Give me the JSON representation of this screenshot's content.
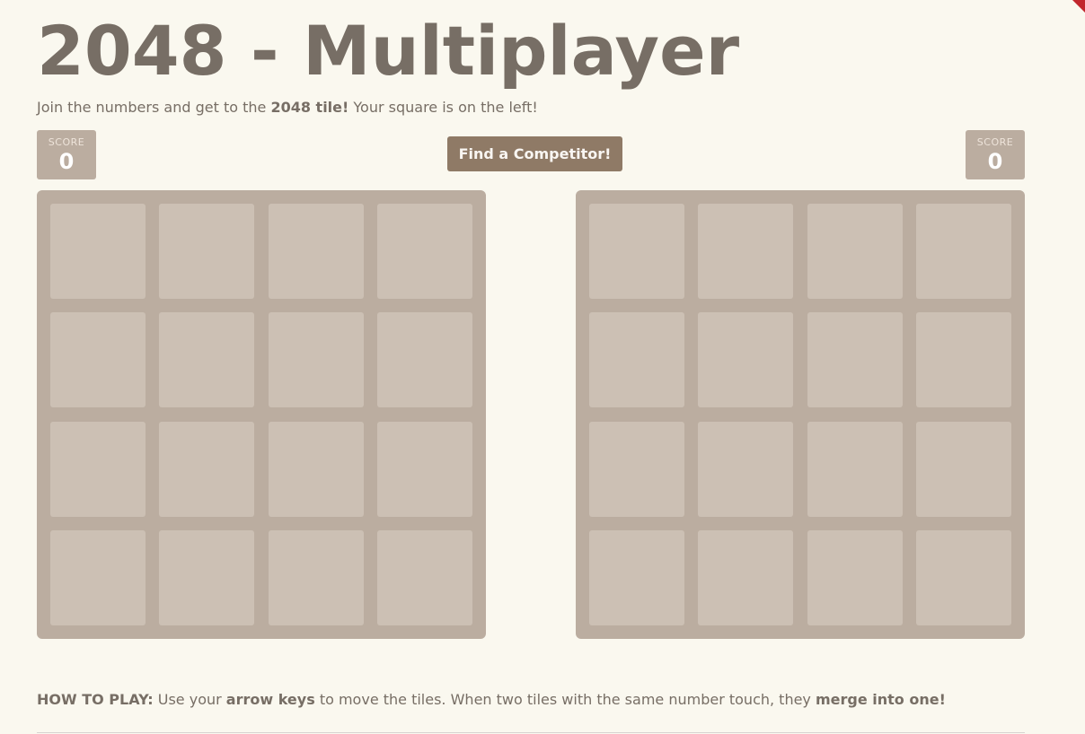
{
  "header": {
    "title": "2048 - Multiplayer"
  },
  "intro": {
    "prefix": "Join the numbers and get to the ",
    "bold": "2048 tile!",
    "suffix": " Your square is on the left!"
  },
  "scores": {
    "left": {
      "label": "SCORE",
      "value": "0"
    },
    "right": {
      "label": "SCORE",
      "value": "0"
    }
  },
  "actions": {
    "find_competitor_label": "Find a Competitor!"
  },
  "boards": {
    "rows": 4,
    "cols": 4,
    "left_tiles": [],
    "right_tiles": []
  },
  "how_to_play": {
    "label": "HOW TO PLAY:",
    "text1": " Use your ",
    "bold1": "arrow keys",
    "text2": " to move the tiles. When two tiles with the same number touch, they ",
    "bold2": "merge into one!"
  },
  "colors": {
    "background": "#faf8ef",
    "text": "#776e65",
    "board": "#bbada0",
    "cell_empty": "#cdc1b4",
    "button": "#8f7a66",
    "button_text": "#f9f6f2",
    "ribbon": "#c1272d"
  }
}
